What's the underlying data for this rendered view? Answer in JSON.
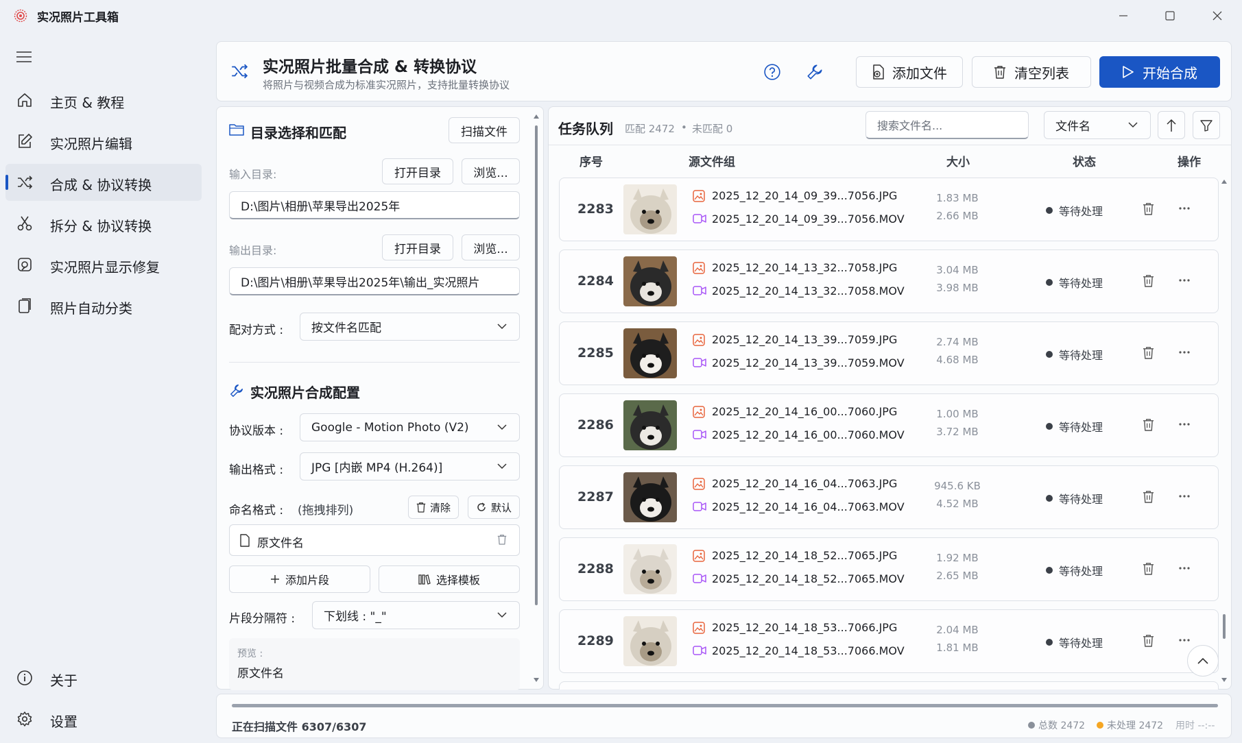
{
  "app": {
    "title": "实况照片工具箱",
    "icon": "live-photo-icon"
  },
  "window_controls": [
    "minimize-icon",
    "maximize-icon",
    "close-icon"
  ],
  "sidebar": {
    "items": [
      {
        "label": "主页 & 教程",
        "icon": "home-icon"
      },
      {
        "label": "实况照片编辑",
        "icon": "edit-icon"
      },
      {
        "label": "合成 & 协议转换",
        "icon": "shuffle-icon",
        "active": true
      },
      {
        "label": "拆分 & 协议转换",
        "icon": "scissors-icon"
      },
      {
        "label": "实况照片显示修复",
        "icon": "repair-icon"
      },
      {
        "label": "照片自动分类",
        "icon": "classify-icon"
      }
    ],
    "bottom": [
      {
        "label": "关于",
        "icon": "info-icon"
      },
      {
        "label": "设置",
        "icon": "gear-icon"
      }
    ]
  },
  "header": {
    "title": "实况照片批量合成 & 转换协议",
    "subtitle": "将照片与视频合成为标准实况照片，支持批量转换协议",
    "add_files": "添加文件",
    "clear_list": "清空列表",
    "start": "开始合成"
  },
  "left": {
    "section1_title": "目录选择和匹配",
    "scan_button": "扫描文件",
    "input_dir_label": "输入目录:",
    "open_dir": "打开目录",
    "browse": "浏览...",
    "input_dir_value": "D:\\图片\\相册\\苹果导出2025年",
    "output_dir_label": "输出目录:",
    "output_dir_value": "D:\\图片\\相册\\苹果导出2025年\\输出_实况照片",
    "match_label": "配对方式 :",
    "match_value": "按文件名匹配",
    "section2_title": "实况照片合成配置",
    "protocol_label": "协议版本 :",
    "protocol_value": "Google - Motion Photo (V2)",
    "format_label": "输出格式 :",
    "format_value": "JPG [内嵌 MP4 (H.264)]",
    "naming_label": "命名格式 :",
    "naming_hint": "(拖拽排列)",
    "clear": "清除",
    "default": "默认",
    "segment_item": "原文件名",
    "add_segment": "添加片段",
    "choose_template": "选择模板",
    "separator_label": "片段分隔符 :",
    "separator_value": "下划线 : \"_\"",
    "preview_label": "预览 :",
    "preview_value": "原文件名"
  },
  "queue": {
    "title": "任务队列",
    "matched": "匹配 2472",
    "bullet": "•",
    "unmatched": "未匹配 0",
    "search_placeholder": "搜索文件名...",
    "sort_value": "文件名",
    "columns": {
      "index": "序号",
      "source": "源文件组",
      "size": "大小",
      "status": "状态",
      "action": "操作"
    },
    "rows": [
      {
        "index": "2283",
        "jpg": "2025_12_20_14_09_39...7056.JPG",
        "mov": "2025_12_20_14_09_39...7056.MOV",
        "jpg_size": "1.83 MB",
        "mov_size": "2.66 MB",
        "status": "等待处理"
      },
      {
        "index": "2284",
        "jpg": "2025_12_20_14_13_32...7058.JPG",
        "mov": "2025_12_20_14_13_32...7058.MOV",
        "jpg_size": "3.04 MB",
        "mov_size": "3.98 MB",
        "status": "等待处理"
      },
      {
        "index": "2285",
        "jpg": "2025_12_20_14_13_39...7059.JPG",
        "mov": "2025_12_20_14_13_39...7059.MOV",
        "jpg_size": "2.74 MB",
        "mov_size": "4.68 MB",
        "status": "等待处理"
      },
      {
        "index": "2286",
        "jpg": "2025_12_20_14_16_00...7060.JPG",
        "mov": "2025_12_20_14_16_00...7060.MOV",
        "jpg_size": "1.00 MB",
        "mov_size": "3.72 MB",
        "status": "等待处理"
      },
      {
        "index": "2287",
        "jpg": "2025_12_20_14_16_04...7063.JPG",
        "mov": "2025_12_20_14_16_04...7063.MOV",
        "jpg_size": "945.6 KB",
        "mov_size": "4.52 MB",
        "status": "等待处理"
      },
      {
        "index": "2288",
        "jpg": "2025_12_20_14_18_52...7065.JPG",
        "mov": "2025_12_20_14_18_52...7065.MOV",
        "jpg_size": "1.92 MB",
        "mov_size": "2.65 MB",
        "status": "等待处理"
      },
      {
        "index": "2289",
        "jpg": "2025_12_20_14_18_53...7066.JPG",
        "mov": "2025_12_20_14_18_53...7066.MOV",
        "jpg_size": "2.04 MB",
        "mov_size": "1.81 MB",
        "status": "等待处理"
      }
    ]
  },
  "statusbar": {
    "progress": 1.0,
    "text": "正在扫描文件 6307/6307",
    "total": "总数 2472",
    "unprocessed": "未处理 2472",
    "elapsed": "用时 --:--"
  },
  "colors": {
    "accent": "#1a56c4",
    "image_icon": "#e8643c",
    "video_icon": "#a855f7",
    "unprocessed_dot": "#f5a623"
  }
}
